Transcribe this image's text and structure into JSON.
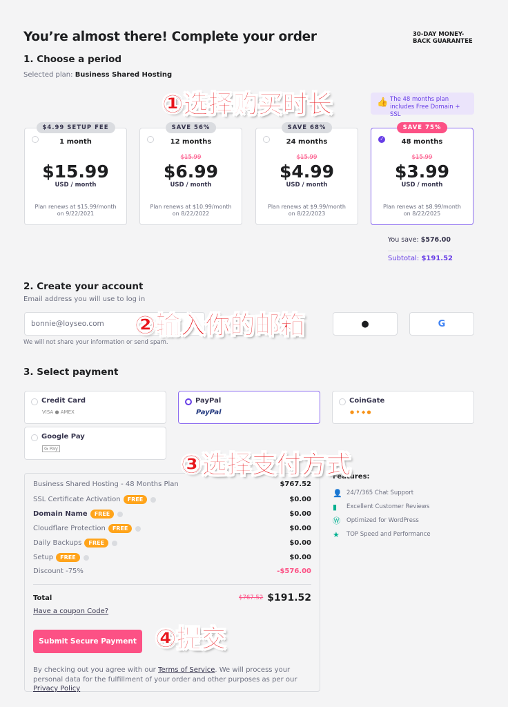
{
  "header": {
    "title": "You’re almost there! Complete your order",
    "guarantee": "30-DAY MONEY-BACK GUARANTEE"
  },
  "period": {
    "heading": "1. Choose a period",
    "selected_label": "Selected plan:",
    "selected_plan": "Business Shared Hosting",
    "info": "The 48 months plan includes Free Domain + SSL",
    "plans": [
      {
        "badge": "$4.99 SETUP FEE",
        "term": "1 month",
        "old": "",
        "price": "$15.99",
        "unit": "USD / month",
        "renew": "Plan renews at $15.99/month",
        "renew_date": "on 9/22/2021",
        "selected": false
      },
      {
        "badge": "SAVE 56%",
        "term": "12 months",
        "old": "$15.99",
        "price": "$6.99",
        "unit": "USD / month",
        "renew": "Plan renews at $10.99/month",
        "renew_date": "on 8/22/2022",
        "selected": false
      },
      {
        "badge": "SAVE 68%",
        "term": "24 months",
        "old": "$15.99",
        "price": "$4.99",
        "unit": "USD / month",
        "renew": "Plan renews at $9.99/month",
        "renew_date": "on 8/22/2023",
        "selected": false
      },
      {
        "badge": "SAVE 75%",
        "term": "48 months",
        "old": "$15.99",
        "price": "$3.99",
        "unit": "USD / month",
        "renew": "Plan renews at $8.99/month",
        "renew_date": "on 8/22/2025",
        "selected": true
      }
    ],
    "you_save_label": "You save:",
    "you_save": "$576.00",
    "subtotal_label": "Subtotal:",
    "subtotal": "$191.52"
  },
  "account": {
    "heading": "2. Create your account",
    "sub": "Email address you will use to log in",
    "email_value": "bonnie@loyseo.com",
    "note": "We will not share your information or send spam."
  },
  "payment": {
    "heading": "3. Select payment",
    "methods": [
      {
        "label": "Credit Card",
        "logo": "VISA ● AMEX"
      },
      {
        "label": "PayPal",
        "logo": "PayPal"
      },
      {
        "label": "CoinGate",
        "logo": "● ♦ ◆ ●"
      },
      {
        "label": "Google Pay",
        "logo": "G Pay"
      }
    ],
    "selected": "PayPal"
  },
  "summary": {
    "rows": [
      {
        "label": "Business Shared Hosting - 48 Months Plan",
        "value": "$767.52"
      },
      {
        "label": "SSL Certificate Activation",
        "badge": "FREE",
        "value": "$0.00"
      },
      {
        "label": "Domain Name",
        "badge": "FREE",
        "value": "$0.00"
      },
      {
        "label": "Cloudflare Protection",
        "badge": "FREE",
        "value": "$0.00"
      },
      {
        "label": "Daily Backups",
        "badge": "FREE",
        "value": "$0.00"
      },
      {
        "label": "Setup",
        "badge": "FREE",
        "value": "$0.00"
      },
      {
        "label": "Discount -75%",
        "value": "-$576.00"
      }
    ],
    "total_label": "Total",
    "total_old": "$767.52",
    "total": "$191.52",
    "coupon": "Have a coupon Code?",
    "submit": "Submit Secure Payment",
    "legal_1": "By checking out you agree with our ",
    "tos": "Terms of Service",
    "legal_2": ". We will process your personal data for the fulfillment of your order and other purposes as per our ",
    "privacy": "Privacy Policy"
  },
  "features": {
    "title": "Features:",
    "items": [
      "24/7/365 Chat Support",
      "Excellent Customer Reviews",
      "Optimized for WordPress",
      "TOP Speed and Performance"
    ]
  },
  "annotations": [
    "①选择购买时长",
    "②输入你的邮箱",
    "③选择支付方式",
    "④提交"
  ],
  "colors": {
    "accent": "#673de6",
    "pink": "#fc5185",
    "orange": "#ffa41b",
    "green": "#00b090"
  }
}
